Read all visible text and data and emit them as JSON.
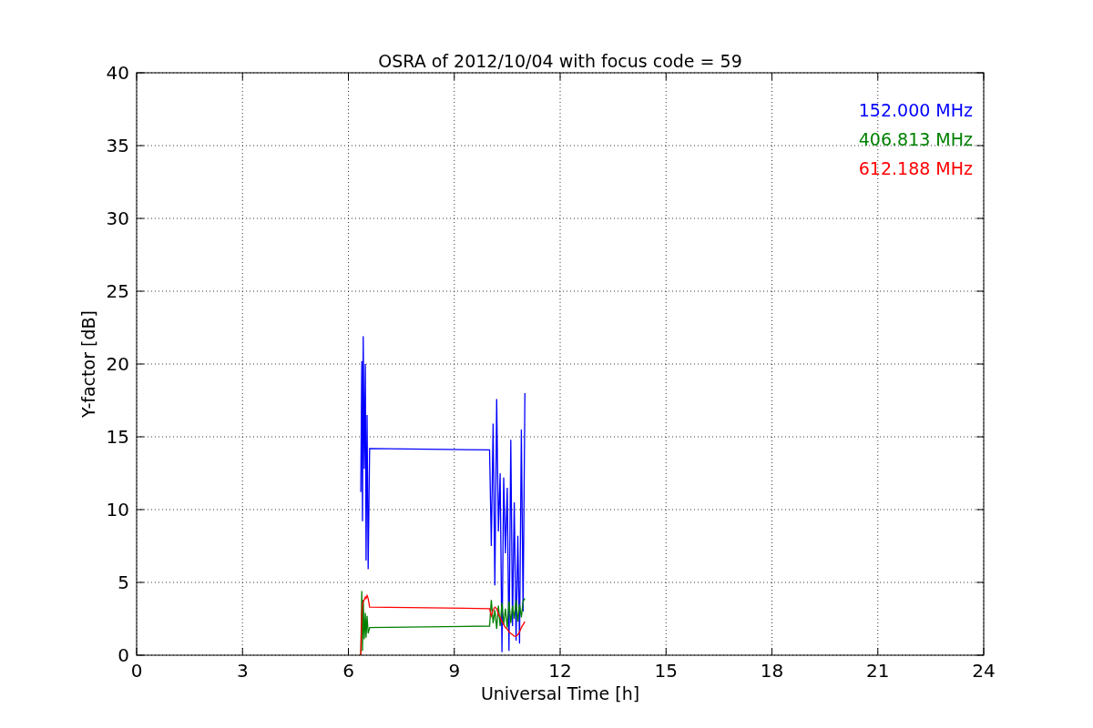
{
  "figure": {
    "chart_data": {
      "type": "line",
      "title": "OSRA of 2012/10/04 with focus code = 59",
      "xlabel": "Universal Time [h]",
      "ylabel": "Y-factor [dB]",
      "x": [
        6.35,
        6.38,
        6.4,
        6.42,
        6.45,
        6.48,
        6.5,
        6.53,
        6.56,
        6.6,
        10.0,
        10.05,
        10.1,
        10.15,
        10.2,
        10.25,
        10.3,
        10.35,
        10.4,
        10.45,
        10.5,
        10.55,
        10.6,
        10.65,
        10.7,
        10.75,
        10.8,
        10.85,
        10.9,
        10.95,
        11.0
      ],
      "series": [
        {
          "name": "152.000 MHz",
          "color": "#0000ff",
          "values": [
            11.2,
            20.2,
            9.2,
            21.9,
            12.8,
            20,
            6.5,
            16.5,
            5.9,
            14.2,
            14.1,
            7.5,
            15.9,
            4.8,
            17.6,
            8.5,
            12.5,
            0.2,
            12.2,
            7,
            11.5,
            0.3,
            14.8,
            2,
            10.5,
            1,
            8.2,
            0.8,
            15.5,
            3,
            18
          ]
        },
        {
          "name": "406.813 MHz",
          "color": "#008000",
          "values": [
            0,
            4.4,
            0.3,
            3.8,
            1.1,
            2.9,
            1.2,
            2.7,
            1.5,
            1.9,
            2.0,
            3.8,
            2.2,
            3.1,
            1.8,
            3.4,
            2.0,
            3.6,
            2.1,
            3.2,
            1.9,
            3.7,
            2.2,
            3.4,
            2.5,
            3.8,
            2.3,
            3.5,
            2.6,
            3.7,
            3.9
          ]
        },
        {
          "name": "612.188 MHz",
          "color": "#ff0000",
          "values": [
            0,
            2.8,
            3.5,
            3.7,
            3.8,
            4.0,
            3.9,
            4.1,
            3.9,
            3.3,
            3.2,
            2.7,
            3.1,
            3.3,
            3.2,
            2.8,
            2.6,
            2.3,
            2.1,
            1.9,
            1.8,
            1.6,
            1.5,
            1.4,
            1.3,
            1.3,
            1.4,
            1.6,
            1.9,
            2.1,
            2.3
          ]
        }
      ],
      "xlim": [
        0,
        24
      ],
      "ylim": [
        0,
        40
      ],
      "xticks": [
        0,
        3,
        6,
        9,
        12,
        15,
        18,
        21,
        24
      ],
      "yticks": [
        0,
        5,
        10,
        15,
        20,
        25,
        30,
        35,
        40
      ],
      "grid": true
    }
  }
}
